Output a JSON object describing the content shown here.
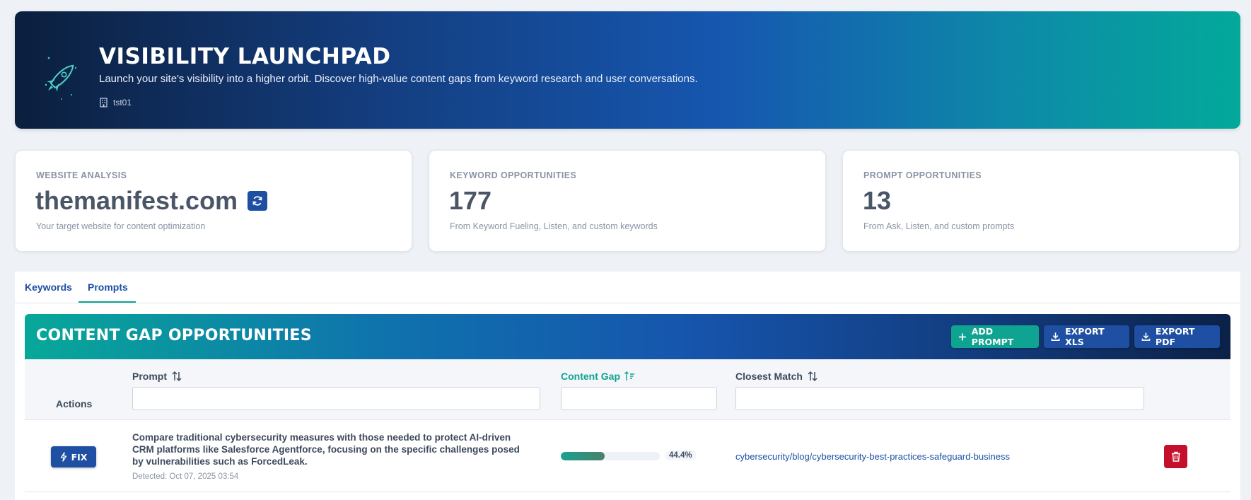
{
  "hero": {
    "title": "VISIBILITY LAUNCHPAD",
    "subtitle": "Launch your site's visibility into a higher orbit. Discover high-value content gaps from keyword research and user conversations.",
    "org": "tst01",
    "icon": "rocket-icon"
  },
  "cards": [
    {
      "label": "WEBSITE ANALYSIS",
      "value": "themanifest.com",
      "desc": "Your target website for content optimization"
    },
    {
      "label": "KEYWORD OPPORTUNITIES",
      "value": "177",
      "desc": "From Keyword Fueling, Listen, and custom keywords"
    },
    {
      "label": "PROMPT OPPORTUNITIES",
      "value": "13",
      "desc": "From Ask, Listen, and custom prompts"
    }
  ],
  "tabs": [
    {
      "label": "Keywords",
      "active": false
    },
    {
      "label": "Prompts",
      "active": true
    }
  ],
  "section": {
    "title": "CONTENT GAP OPPORTUNITIES",
    "buttons": {
      "add": "ADD PROMPT",
      "xls": "EXPORT XLS",
      "pdf": "EXPORT PDF"
    }
  },
  "table": {
    "columns": {
      "actions": "Actions",
      "prompt": "Prompt",
      "gap": "Content Gap",
      "closest": "Closest Match"
    },
    "rows": [
      {
        "action": "FIX",
        "prompt": "Compare traditional cybersecurity measures with those needed to protect AI-driven CRM platforms like Salesforce Agentforce, focusing on the specific challenges posed by vulnerabilities such as ForcedLeak.",
        "detected": "Detected: Oct 07, 2025 03:54",
        "gap_value": 44.4,
        "gap_label": "44.4%",
        "closest": "cybersecurity/blog/cybersecurity-best-practices-safeguard-business"
      }
    ]
  },
  "colors": {
    "accent": "#0fa392",
    "primary": "#1e4fa3",
    "danger": "#c5102d"
  }
}
